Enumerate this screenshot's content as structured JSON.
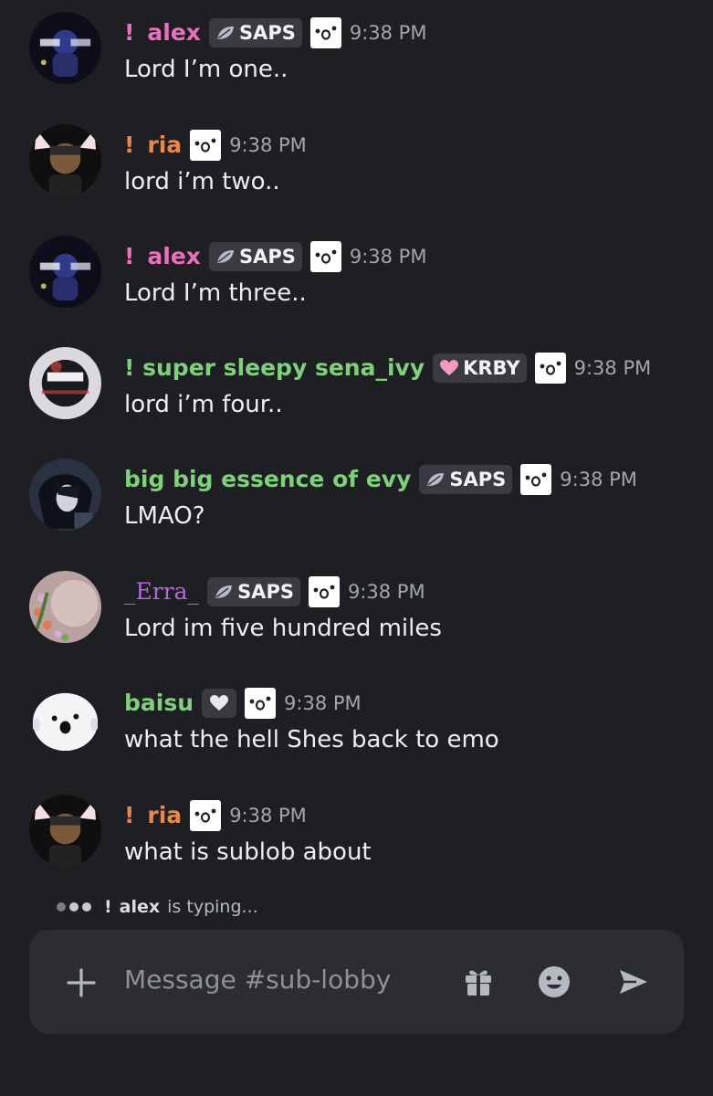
{
  "messages": [
    {
      "name": "alex",
      "prefix": "!",
      "name_color": "#eb6fbd",
      "tag": "SAPS",
      "tag_icon": "leaf-icon",
      "time": "9:38 PM",
      "text": "Lord I’m one..",
      "avatar": "dark-hooded-figure"
    },
    {
      "name": "ria",
      "prefix": "!",
      "name_color": "#e8874a",
      "tag": "",
      "tag_icon": "",
      "time": "9:38 PM",
      "text": "lord i’m two..",
      "avatar": "cat-ear-figure"
    },
    {
      "name": "alex",
      "prefix": "!",
      "name_color": "#eb6fbd",
      "tag": "SAPS",
      "tag_icon": "leaf-icon",
      "time": "9:38 PM",
      "text": "Lord I’m three..",
      "avatar": "dark-hooded-figure"
    },
    {
      "name": "super sleepy sena_ivy",
      "prefix": "!",
      "name_color": "#7ed07a",
      "tag": "KRBY",
      "tag_icon": "heart-icon",
      "time": "9:38 PM",
      "text": "lord i’m four..",
      "avatar": "glitch-figure"
    },
    {
      "name": "big big essence of evy",
      "prefix": "",
      "name_color": "#7ed07a",
      "tag": "SAPS",
      "tag_icon": "leaf-icon",
      "time": "9:38 PM",
      "text": "LMAO?",
      "avatar": "dark-haired-figure"
    },
    {
      "name": "_Erra_",
      "prefix": "",
      "name_color": "#b36ad6",
      "tag": "SAPS",
      "tag_icon": "leaf-icon",
      "time": "9:38 PM",
      "text": "Lord im five hundred miles",
      "avatar": "floral-pink"
    },
    {
      "name": "baisu",
      "prefix": "",
      "name_color": "#7ed07a",
      "tag": "",
      "tag_icon": "heart-icon",
      "time": "9:38 PM",
      "text": "what the hell Shes back to emo",
      "avatar": "white-blob-face"
    },
    {
      "name": "ria",
      "prefix": "!",
      "name_color": "#e8874a",
      "tag": "",
      "tag_icon": "",
      "time": "9:38 PM",
      "text": "what is sublob about",
      "avatar": "cat-ear-figure"
    }
  ],
  "typing": {
    "prefix": "!",
    "name": "alex",
    "suffix": "is typing..."
  },
  "composer": {
    "placeholder": "Message #sub-lobby"
  },
  "icons": {
    "add": "plus-icon",
    "gift": "gift-icon",
    "emoji": "emoji-icon",
    "send": "send-icon"
  },
  "colors": {
    "background": "#1e1f22",
    "composer": "#2b2d31",
    "tag_bg": "#3a3b41",
    "timestamp": "#a3a6ad"
  }
}
